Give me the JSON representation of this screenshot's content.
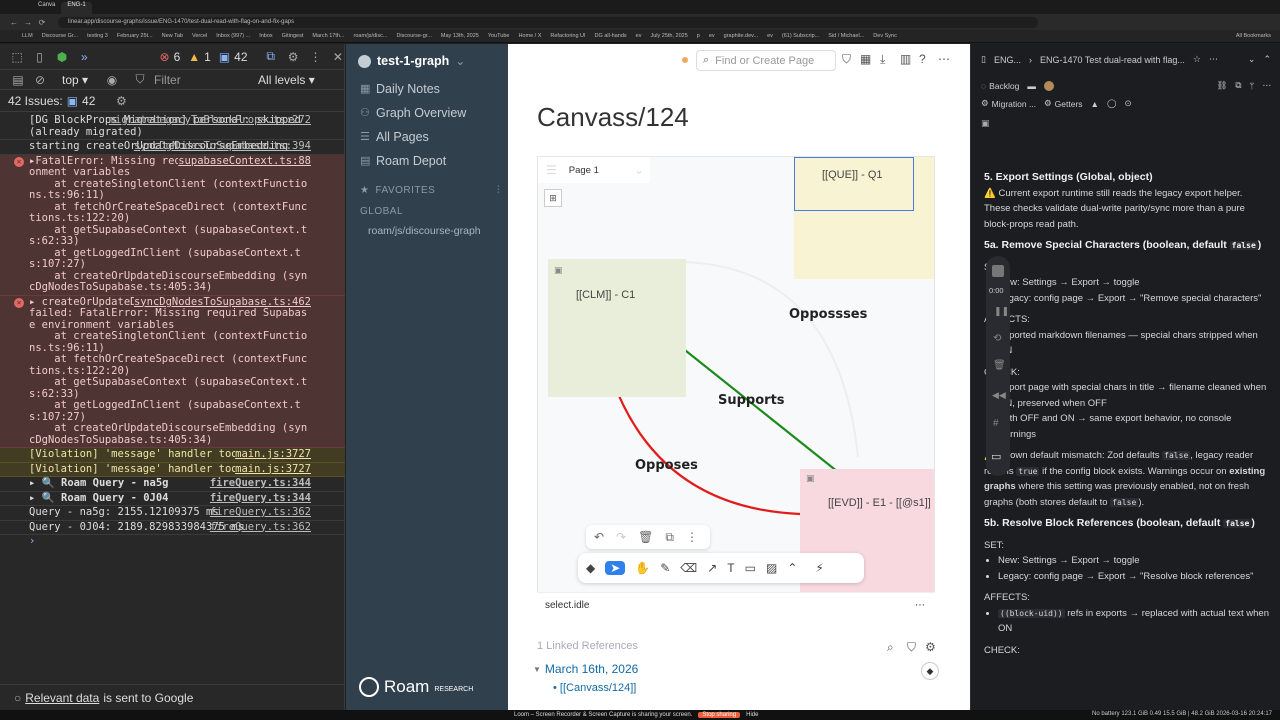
{
  "browser": {
    "tabs": [
      "Canva",
      "ENG-1"
    ],
    "url": "linear.app/discourse-graphs/issue/ENG-1470/test-dual-read-with-flag-on-and-fix-gaps",
    "bookmarks": [
      "LLM",
      "Discourse Gr...",
      "testing 3",
      "February 25t...",
      "New Tab",
      "Vercel",
      "Inbox (997) ...",
      "Inbox",
      "Gitingest",
      "March 17th...",
      "roam/js/disc...",
      "Discourse-gr...",
      "May 13th, 2025",
      "YouTube",
      "Home / X",
      "Refactoring UI",
      "DG all-hands",
      "ev",
      "July 25th, 2025",
      "p",
      "ev",
      "graphite.dev...",
      "ev",
      "(61) Subscrip...",
      "Sid / Michael...",
      "Dev Sync",
      "All Bookmarks"
    ]
  },
  "devtools": {
    "counts": {
      "errors": "6",
      "warnings": "1",
      "messages": "42"
    },
    "context": "top",
    "filter_placeholder": "Filter",
    "levels": "All levels ▾",
    "issues_label": "42 Issues:",
    "issues_count": "42",
    "logs": [
      {
        "type": "log",
        "text": "[DG BlockProps Migration] personal: skipped (already migrated)",
        "src": "migrateLegacyToBlockProps.ts:272"
      },
      {
        "type": "log",
        "text": "starting createOrUpdateDiscourseEmbedding",
        "src": "syncDgNodesToSupabase.ts:394"
      },
      {
        "type": "err",
        "text": "▸FatalError: Missing required Supabase environment variables\n    at createSingletonClient (contextFunctions.ts:96:11)\n    at fetchOrCreateSpaceDirect (contextFunctions.ts:122:20)\n    at getSupabaseContext (supabaseContext.ts:62:33)\n    at getLoggedInClient (supabaseContext.ts:107:27)\n    at createOrUpdateDiscourseEmbedding (syncDgNodesToSupabase.ts:405:34)",
        "src": "supabaseContext.ts:88"
      },
      {
        "type": "err",
        "text": "▸ createOrUpdateDiscourseEmbedding: Process failed: FatalError: Missing required Supabase environment variables\n    at createSingletonClient (contextFunctions.ts:96:11)\n    at fetchOrCreateSpaceDirect (contextFunctions.ts:122:20)\n    at getSupabaseContext (supabaseContext.ts:62:33)\n    at getLoggedInClient (supabaseContext.ts:107:27)\n    at createOrUpdateDiscourseEmbedding (syncDgNodesToSupabase.ts:405:34)",
        "src": "syncDgNodesToSupabase.ts:462"
      },
      {
        "type": "warn",
        "text": "[Violation] 'message' handler took 209ms",
        "src": "main.js:3727"
      },
      {
        "type": "warn",
        "text": "[Violation] 'message' handler took 190ms",
        "src": "main.js:3727"
      },
      {
        "type": "grp",
        "text": "▸ 🔍 Roam Query - na5g",
        "src": "fireQuery.ts:344"
      },
      {
        "type": "grp",
        "text": "▸ 🔍 Roam Query - 0J04",
        "src": "fireQuery.ts:344"
      },
      {
        "type": "log",
        "text": "Query - na5g: 2155.12109375 ms",
        "src": "fireQuery.ts:362"
      },
      {
        "type": "log",
        "text": "Query - 0J04: 2189.829833984375 ms",
        "src": "fireQuery.ts:362"
      }
    ],
    "prompt": "›",
    "footer_link": "Relevant data",
    "footer_rest": " is sent to Google"
  },
  "roam": {
    "graph_name": "test-1-graph",
    "nav": [
      {
        "label": "Daily Notes",
        "icon": "calendar-icon"
      },
      {
        "label": "Graph Overview",
        "icon": "graph-icon"
      },
      {
        "label": "All Pages",
        "icon": "list-icon"
      },
      {
        "label": "Roam Depot",
        "icon": "shop-icon"
      }
    ],
    "favorites_label": "FAVORITES",
    "global_label": "GLOBAL",
    "global_item": "roam/js/discourse-graph",
    "logo_text": "Roam",
    "logo_sub": "RESEARCH"
  },
  "main": {
    "search_placeholder": "Find or Create Page",
    "title": "Canvass/124",
    "canvas": {
      "page_label": "Page 1",
      "nodes": {
        "que": "[[QUE]] - Q1",
        "clm": "[[CLM]] - C1",
        "evd": "[[EVD]] - E1 - [[@s1]]"
      },
      "edges": {
        "opposes_top": "Oppossses",
        "supports": "Supports",
        "opposes": "Opposes"
      },
      "status": "select.idle",
      "colors": {
        "que": "#f8f3d2",
        "clm": "#e8eed9",
        "evd": "#f8d9df",
        "supports": "#1e8a1e",
        "opposes": "#e21b1b"
      }
    },
    "linked_refs": "1 Linked References",
    "ref_date": "March 16th, 2026",
    "ref_item": "[[Canvass/124]]"
  },
  "issue": {
    "breadcrumb_team": "ENG...",
    "breadcrumb_issue": "ENG-1470  Test dual-read with flag...",
    "status": "Backlog",
    "tags": [
      "Migration ...",
      "Getters"
    ],
    "content": {
      "h5": "5. Export Settings (Global, object)",
      "warn1": "⚠️ Current export runtime still reads the legacy export helper. These checks validate dual-write parity/sync more than a pure block-props read path.",
      "h5a": "5a. Remove Special Characters (boolean, default ",
      "false": "false",
      "close": ")",
      "set_label": "SET:",
      "new_settings": "New: Settings → Export → toggle",
      "legacy_remove": "Legacy: config page → Export → \"Remove special characters\"",
      "affects_label": "AFFECTS:",
      "affects_remove": "Exported markdown filenames — special chars stripped when ON",
      "check_label": "CHECK:",
      "check1": "Export page with special chars in title → filename cleaned when ON, preserved when OFF",
      "check2": "Both OFF and ON → same export behavior, no console warnings",
      "known": "⚠️ Known default mismatch: Zod defaults ",
      "known2": ", legacy reader returns ",
      "true": "true",
      "known3": " if the config block exists. Warnings occur on ",
      "existing": "existing graphs",
      "known4": " where this setting was previously enabled, not on fresh graphs (both stores default to ",
      "known5": ").",
      "h5b": "5b. Resolve Block References (boolean, default ",
      "legacy_resolve": "Legacy: config page → Export → \"Resolve block references\"",
      "uid_code": "((block-uid))",
      "affects_resolve": " refs in exports → replaced with actual text when ON",
      "check_last": "CHECK:"
    }
  },
  "recorder": {
    "timer": "0:00"
  },
  "loom": {
    "text": "Loom – Screen Recorder & Screen Capture is sharing your screen.",
    "stop": "Stop sharing",
    "hide": "Hide"
  },
  "statusline": "No battery  123.1 GiB 0.49 15.5 GiB | 48.2 GiB 2026-03-16 20:24:17"
}
